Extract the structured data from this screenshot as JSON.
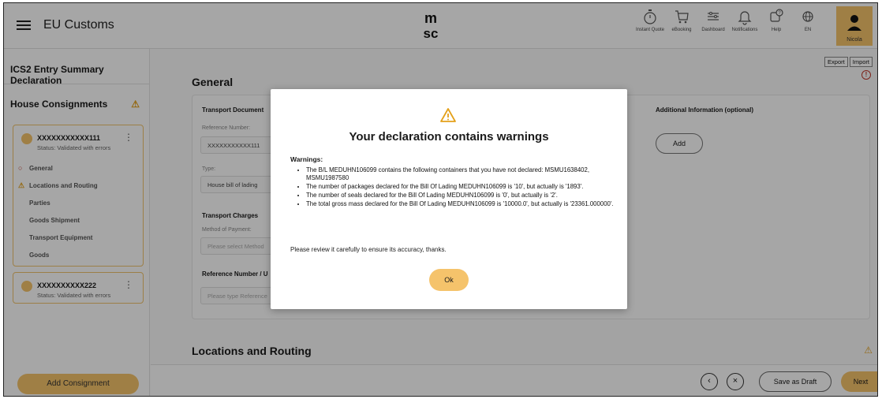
{
  "header": {
    "app_title": "EU Customs",
    "nav": [
      {
        "label": "Instant Quote",
        "icon": "stopwatch-icon"
      },
      {
        "label": "eBooking",
        "icon": "cart-icon"
      },
      {
        "label": "Dashboard",
        "icon": "dashboard-icon"
      },
      {
        "label": "Notifications",
        "icon": "bell-icon"
      },
      {
        "label": "Help",
        "icon": "help-icon"
      },
      {
        "label": "EN",
        "icon": "globe-icon"
      }
    ],
    "user_label": "Nicola"
  },
  "sidebar": {
    "title": "ICS2 Entry Summary Declaration",
    "section_title": "House Consignments",
    "consignments": [
      {
        "number": "XXXXXXXXXXX111",
        "status": "Status: Validated with errors",
        "menu": [
          {
            "label": "General",
            "state": "error"
          },
          {
            "label": "Locations and Routing",
            "state": "warning"
          },
          {
            "label": "Parties",
            "state": "none"
          },
          {
            "label": "Goods Shipment",
            "state": "none"
          },
          {
            "label": "Transport Equipment",
            "state": "none"
          },
          {
            "label": "Goods",
            "state": "none"
          }
        ]
      },
      {
        "number": "XXXXXXXXXX222",
        "status": "Status: Validated with errors"
      }
    ],
    "add_button": "Add Consignment"
  },
  "main": {
    "export_label": "Export",
    "import_label": "Import",
    "section_general": "General",
    "transport_document": "Transport Document",
    "reference_number_label": "Reference Number:",
    "reference_number_value": "XXXXXXXXXXX111",
    "type_label": "Type:",
    "type_value": "House bill of lading",
    "transport_charges": "Transport Charges",
    "method_of_payment_label": "Method of Payment:",
    "method_of_payment_placeholder": "Please select Method",
    "reference_number_u": "Reference Number / U",
    "reference_placeholder": "Please type Reference",
    "additional_info": "Additional Information (optional)",
    "add_button": "Add",
    "section_locations": "Locations and Routing"
  },
  "footer": {
    "back_icon": "chevron-left-icon",
    "close_icon": "close-icon",
    "save_draft": "Save as Draft",
    "next": "Next"
  },
  "modal": {
    "title": "Your declaration contains warnings",
    "warnings_label": "Warnings:",
    "warnings": [
      "The B/L MEDUHN106099 contains the following containers that you have not declared: MSMU1638402, MSMU1987580",
      "The number of packages declared for the Bill Of Lading MEDUHN106099 is '10', but actually is '1893'.",
      "The number of seals declared for the Bill Of Lading MEDUHN106099 is '0', but actually is '2'.",
      "The total gross mass declared for the Bill Of Lading MEDUHN106099 is '10000.0', but actually is '23361.000000'."
    ],
    "review_text": "Please review it carefully to ensure its accuracy, thanks.",
    "ok_button": "Ok"
  },
  "colors": {
    "accent": "#f5c36b",
    "warning": "#e4a11b",
    "error": "#c0392b"
  }
}
